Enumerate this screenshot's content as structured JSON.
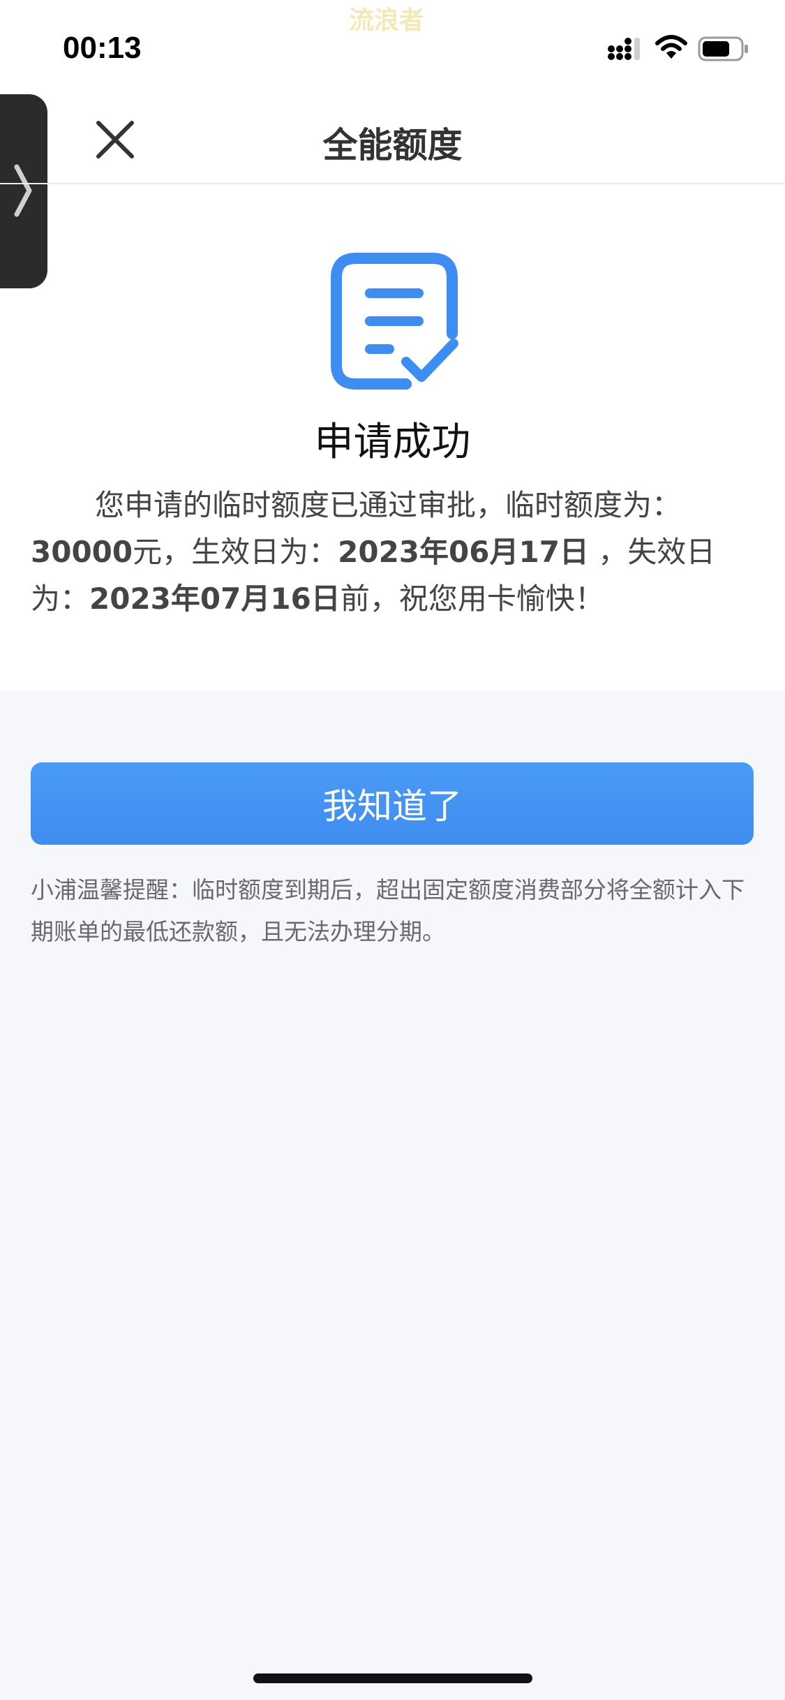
{
  "status_bar": {
    "time": "00:13",
    "watermark": "流浪者"
  },
  "nav": {
    "title": "全能额度",
    "close_icon": "close-icon"
  },
  "result": {
    "icon": "document-check-icon",
    "accent_color": "#3d8ef0",
    "title": "申请成功",
    "desc_part1": "您申请的临时额度已通过审批，临时额度为：",
    "amount": "30000",
    "desc_part2": "元，生效日为：",
    "effective_date": "2023年06月17日",
    "desc_part3": " ，失效日为：",
    "expiry_date": "2023年07月16日",
    "desc_part4": "前，祝您用卡愉快！"
  },
  "button": {
    "label": "我知道了",
    "color": "#4596f3"
  },
  "tip": {
    "text": "小浦温馨提醒：临时额度到期后，超出固定额度消费部分将全额计入下期账单的最低还款额，且无法办理分期。"
  }
}
